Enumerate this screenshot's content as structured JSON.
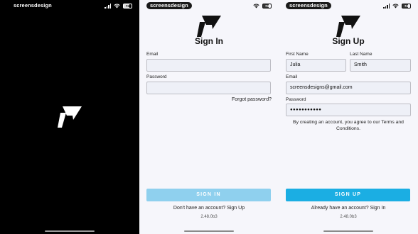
{
  "screens": {
    "splash": {
      "watermark": "screensdesign",
      "battery": "74",
      "battery_level": 0.74
    },
    "signin": {
      "watermark": "screensdesign",
      "battery": "74",
      "battery_level": 0.74,
      "title": "Sign In",
      "email_label": "Email",
      "email_value": "",
      "password_label": "Password",
      "password_value": "",
      "forgot_password": "Forgot password?",
      "button": "SIGN IN",
      "footer_link": "Don't have an account? Sign Up",
      "version": "2.48.0b3"
    },
    "signup": {
      "watermark": "screensdesign",
      "battery": "74",
      "battery_level": 0.74,
      "title": "Sign Up",
      "first_name_label": "First Name",
      "first_name_value": "Julia",
      "last_name_label": "Last Name",
      "last_name_value": "Smith",
      "email_label": "Email",
      "email_value": "screensdesigns@gmail.com",
      "password_label": "Password",
      "password_value": "●●●●●●●●●●●",
      "consent": "By creating an account, you agree to our Terms and Conditions.",
      "button": "SIGN UP",
      "footer_link": "Already have an account? Sign In",
      "version": "2.48.0b3"
    }
  },
  "colors": {
    "splash_background": "#000000",
    "screen_background": "#f6f6fb",
    "signin_button_disabled": "#8fd0ee",
    "signup_button": "#1baee3"
  },
  "icons": [
    "app-logo-icon",
    "cellular-signal-icon",
    "wifi-icon",
    "battery-icon"
  ]
}
